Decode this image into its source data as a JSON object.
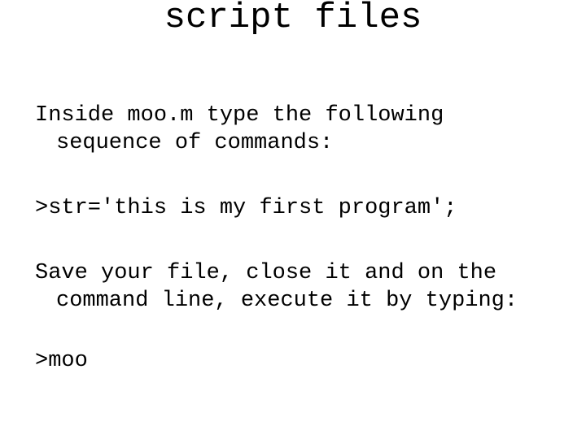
{
  "slide": {
    "title": "script files",
    "background_color": "#ffffff",
    "text_color": "#000000",
    "paragraphs": [
      {
        "id": "intro-instruction",
        "line1": "Inside moo.m type the following",
        "line2": "sequence of commands:"
      },
      {
        "id": "command-assignment",
        "line1": ">str='this is my first program';",
        "line2": ""
      },
      {
        "id": "save-instruction",
        "line1": "Save your file, close it and on the",
        "line2": "command line, execute it by typing:"
      },
      {
        "id": "command-run",
        "line1": ">moo",
        "line2": ""
      }
    ]
  }
}
